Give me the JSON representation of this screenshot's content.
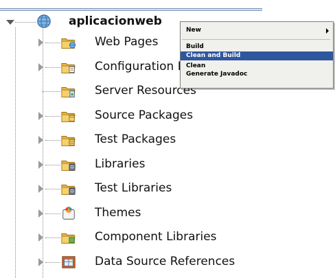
{
  "tree": {
    "root": {
      "label": "aplicacionweb",
      "icon": "globe-icon"
    },
    "items": [
      {
        "label": "Web Pages",
        "icon": "folder-web-icon",
        "expandable": true
      },
      {
        "label": "Configuration Files",
        "icon": "folder-config-icon",
        "expandable": true
      },
      {
        "label": "Server Resources",
        "icon": "folder-server-icon",
        "expandable": false
      },
      {
        "label": "Source Packages",
        "icon": "folder-source-icon",
        "expandable": true
      },
      {
        "label": "Test Packages",
        "icon": "folder-test-icon",
        "expandable": true
      },
      {
        "label": "Libraries",
        "icon": "folder-library-icon",
        "expandable": true
      },
      {
        "label": "Test Libraries",
        "icon": "folder-test-library-icon",
        "expandable": true
      },
      {
        "label": "Themes",
        "icon": "themes-icon",
        "expandable": true
      },
      {
        "label": "Component Libraries",
        "icon": "folder-component-icon",
        "expandable": true
      },
      {
        "label": "Data Source References",
        "icon": "data-source-icon",
        "expandable": true
      }
    ]
  },
  "context_menu": {
    "items": [
      {
        "label": "New",
        "has_submenu": true,
        "selected": false
      },
      {
        "label": "Build",
        "has_submenu": false,
        "selected": false
      },
      {
        "label": "Clean and Build",
        "has_submenu": false,
        "selected": true
      },
      {
        "label": "Clean",
        "has_submenu": false,
        "selected": false
      },
      {
        "label": "Generate Javadoc",
        "has_submenu": false,
        "selected": false
      }
    ]
  },
  "colors": {
    "menu_selection": "#30579e",
    "menu_background": "#f0f0ec",
    "folder": "#e8b84a"
  }
}
